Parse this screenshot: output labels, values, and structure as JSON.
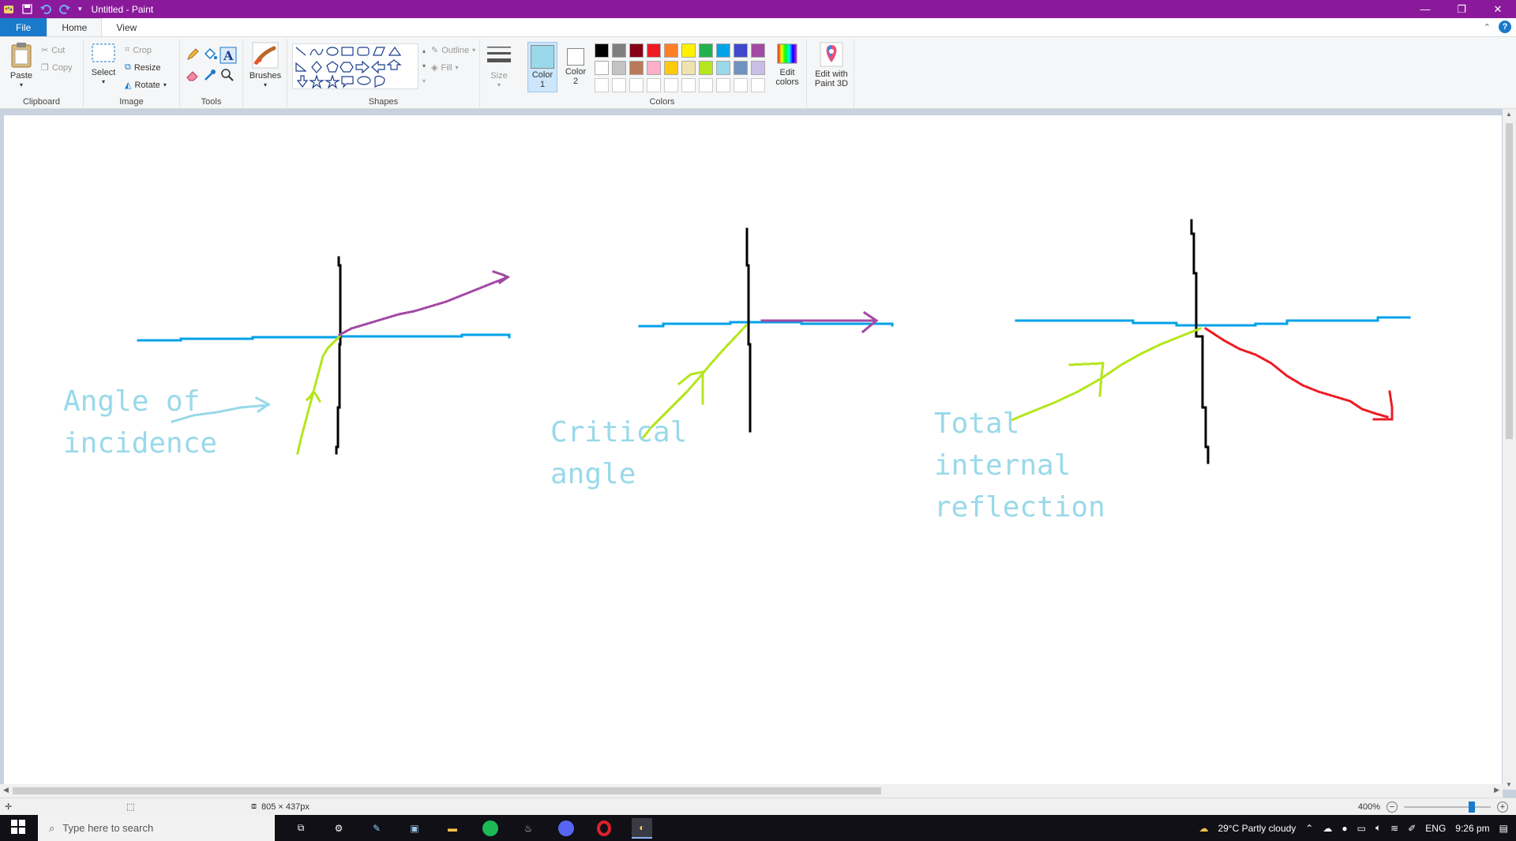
{
  "window": {
    "title": "Untitled - Paint",
    "controls": [
      "minimize",
      "restore",
      "close"
    ]
  },
  "tabs": [
    {
      "label": "File"
    },
    {
      "label": "Home"
    },
    {
      "label": "View"
    }
  ],
  "ribbon": {
    "clipboard": {
      "group_label": "Clipboard",
      "paste": "Paste",
      "cut": "Cut",
      "copy": "Copy"
    },
    "image": {
      "group_label": "Image",
      "select": "Select",
      "crop": "Crop",
      "resize": "Resize",
      "rotate": "Rotate"
    },
    "tools": {
      "group_label": "Tools"
    },
    "brushes": {
      "label": "Brushes"
    },
    "shapes": {
      "group_label": "Shapes",
      "outline": "Outline",
      "fill": "Fill"
    },
    "size": {
      "label": "Size"
    },
    "colors": {
      "group_label": "Colors",
      "color1": "Color\n1",
      "color1_a": "Color",
      "color1_b": "1",
      "color2_a": "Color",
      "color2_b": "2",
      "color1_value": "#99d9ea",
      "color2_value": "#ffffff",
      "edit_colors_a": "Edit",
      "edit_colors_b": "colors",
      "palette_row1": [
        "#000000",
        "#7f7f7f",
        "#880015",
        "#ed1c24",
        "#ff7f27",
        "#fff200",
        "#22b14c",
        "#00a2e8",
        "#3f48cc",
        "#a349a4"
      ],
      "palette_row2": [
        "#ffffff",
        "#c3c3c3",
        "#b97a57",
        "#ffaec9",
        "#ffc90e",
        "#efe4b0",
        "#b5e61d",
        "#99d9ea",
        "#7092be",
        "#c8bfe7"
      ],
      "palette_row3": [
        "#ffffff",
        "#ffffff",
        "#ffffff",
        "#ffffff",
        "#ffffff",
        "#ffffff",
        "#ffffff",
        "#ffffff",
        "#ffffff",
        "#ffffff"
      ]
    },
    "paint3d": {
      "label_a": "Edit with",
      "label_b": "Paint 3D"
    }
  },
  "drawing": {
    "labels": {
      "angle_line1": "Angle of",
      "angle_line2": "incidence",
      "critical_line1": "Critical",
      "critical_line2": "angle",
      "tir_line1": "Total",
      "tir_line2": "internal",
      "tir_line3": "reflection"
    },
    "colors": {
      "surface": "#00a2e8",
      "normal": "#000000",
      "incident": "#b5e61d",
      "refracted": "#a349a4",
      "reflected": "#ed1c24",
      "label": "#99d9ea"
    }
  },
  "status": {
    "dimensions": "805 × 437px",
    "zoom": "400%",
    "zoom_level": 0.8
  },
  "taskbar": {
    "search_placeholder": "Type here to search",
    "weather": "29°C  Partly cloudy",
    "language": "ENG",
    "time": "9:26 pm"
  }
}
